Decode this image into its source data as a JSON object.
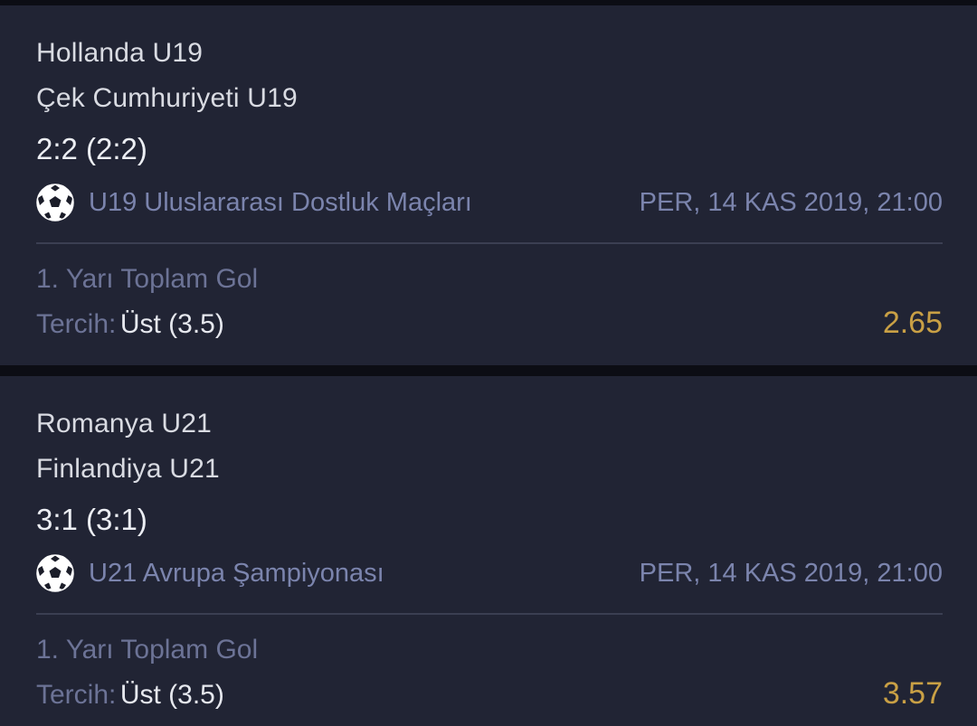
{
  "bets": [
    {
      "home_team": "Hollanda U19",
      "away_team": "Çek Cumhuriyeti U19",
      "score": "2:2 (2:2)",
      "league": "U19 Uluslararası Dostluk Maçları",
      "date": "PER, 14 KAS 2019, 21:00",
      "market": "1. Yarı Toplam Gol",
      "pick_label": "Tercih:",
      "pick_value": "Üst (3.5)",
      "odds": "2.65",
      "sport_icon": "soccer-ball-icon"
    },
    {
      "home_team": "Romanya U21",
      "away_team": "Finlandiya U21",
      "score": "3:1 (3:1)",
      "league": "U21 Avrupa Şampiyonası",
      "date": "PER, 14 KAS 2019, 21:00",
      "market": "1. Yarı Toplam Gol",
      "pick_label": "Tercih:",
      "pick_value": "Üst (3.5)",
      "odds": "3.57",
      "sport_icon": "soccer-ball-icon"
    }
  ],
  "colors": {
    "background": "#0c0d14",
    "card": "#212434",
    "muted_text": "#7b84ad",
    "odds": "#c9a045"
  }
}
